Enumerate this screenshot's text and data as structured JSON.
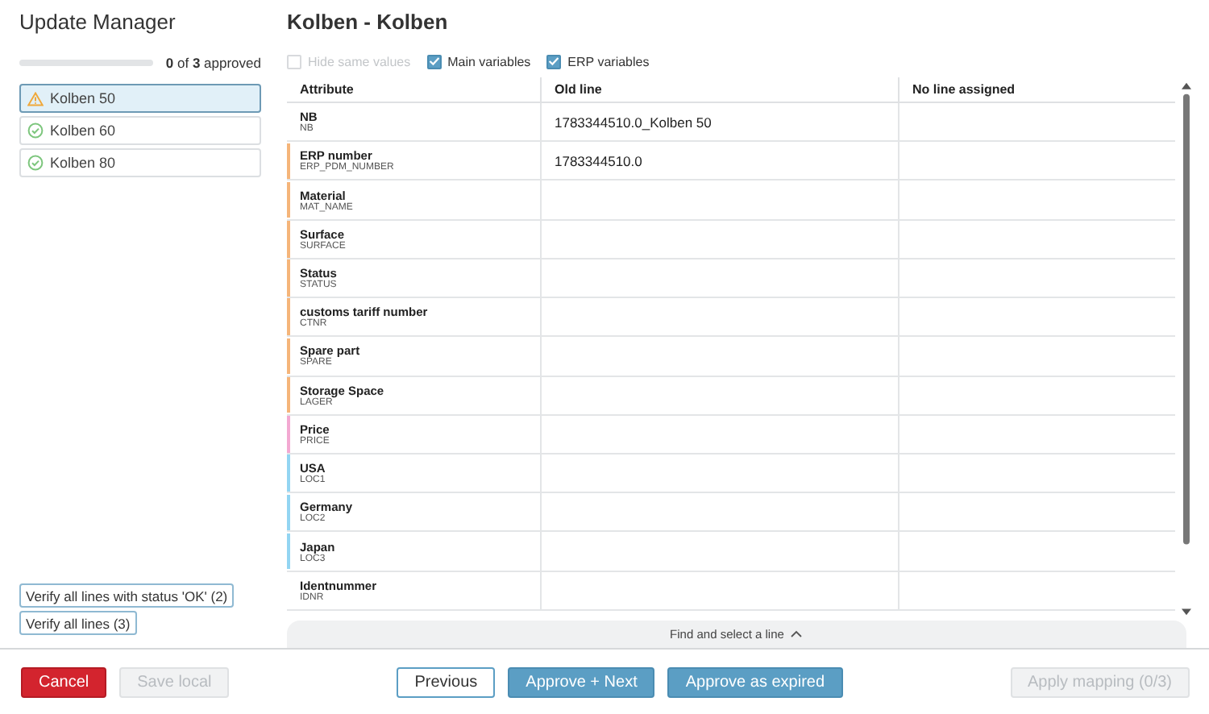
{
  "sidebar": {
    "title": "Update Manager",
    "progress": {
      "level": 0,
      "label": "**0** of **3** approved"
    },
    "items": [
      {
        "label": "Kolben 50",
        "kind": "warning",
        "selected": true
      },
      {
        "label": "Kolben 60",
        "kind": "ok",
        "selected": false
      },
      {
        "label": "Kolben 80",
        "kind": "ok",
        "selected": false
      }
    ],
    "verify_buttons": [
      "Verify all lines with status 'OK' (2)",
      "Verify all lines (3)"
    ]
  },
  "main": {
    "title": "Kolben - Kolben",
    "filters": [
      {
        "label": "Hide same values",
        "checked": false,
        "disabled": true
      },
      {
        "label": "Main variables",
        "checked": true,
        "disabled": false
      },
      {
        "label": "ERP variables",
        "checked": true,
        "disabled": false
      }
    ],
    "table": {
      "columns": [
        "Attribute",
        "Old line",
        "No line assigned"
      ],
      "rows": [
        {
          "name": "NB",
          "code": "NB",
          "old": "1783344510.0_Kolben 50"
        },
        {
          "name": "ERP number",
          "code": "ERP_PDM_NUMBER",
          "old": "1783344510.0",
          "color": "#f5b57a"
        },
        {
          "name": "Material",
          "code": "MAT_NAME",
          "color": "#f5b57a"
        },
        {
          "name": "Surface",
          "code": "SURFACE",
          "color": "#f5b57a"
        },
        {
          "name": "Status",
          "code": "STATUS",
          "color": "#f5b57a"
        },
        {
          "name": "customs tariff number",
          "code": "CTNR",
          "color": "#f5b57a"
        },
        {
          "name": "Spare part",
          "code": "SPARE",
          "color": "#f5b57a"
        },
        {
          "name": "Storage Space",
          "code": "LAGER",
          "color": "#f5b57a"
        },
        {
          "name": "Price",
          "code": "PRICE",
          "color": "#f3a9d2"
        },
        {
          "name": "USA",
          "code": "LOC1",
          "color": "#93d5f2"
        },
        {
          "name": "Germany",
          "code": "LOC2",
          "color": "#93d5f2"
        },
        {
          "name": "Japan",
          "code": "LOC3",
          "color": "#93d5f2"
        },
        {
          "name": "Identnummer",
          "code": "IDNR"
        }
      ]
    },
    "find_bar": {
      "label": "Find and select a line",
      "expanded": false
    }
  },
  "footer": {
    "left": [
      {
        "label": "Cancel",
        "kind": "danger",
        "disabled": false
      },
      {
        "label": "Save local",
        "kind": "plain",
        "disabled": true
      }
    ],
    "center": [
      {
        "label": "Previous",
        "kind": "outline",
        "disabled": false
      },
      {
        "label": "Approve + Next",
        "kind": "primary",
        "disabled": false
      },
      {
        "label": "Approve as expired",
        "kind": "primary",
        "disabled": false
      }
    ],
    "right": [
      {
        "label": "Apply mapping (0/3)",
        "kind": "plain",
        "disabled": true
      }
    ]
  }
}
